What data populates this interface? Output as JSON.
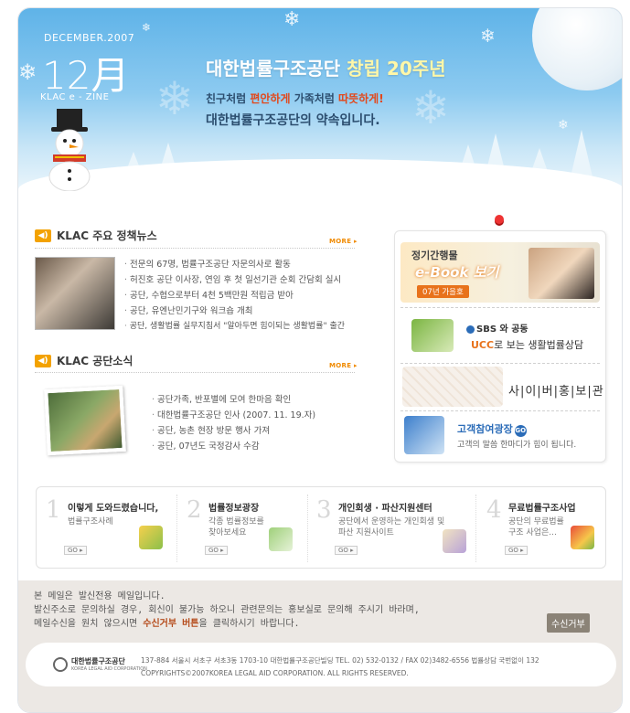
{
  "header": {
    "date_small": "DECEMBER.2007",
    "month": "12月",
    "zine": "KLAC e - ZINE",
    "title_main": "대한법률구조공단",
    "title_accent": "창립 20주년",
    "sub1_pre": "친구처럼 ",
    "sub1_hl1": "편안하게",
    "sub1_mid": " 가족처럼 ",
    "sub1_hl2": "따뜻하게!",
    "sub2": "대한법률구조공단의 약속입니다."
  },
  "policy_news": {
    "title": "KLAC 주요 정책뉴스",
    "more": "MORE ▸",
    "items": [
      "전문의 67명, 법률구조공단 자문의사로 활동",
      "허진호 공단 이사장, 연임 후 첫 일선기관 순회 간담회 실시",
      "공단, 수협으로부터 4천 5백만원 적립금 받아",
      "공단, 유엔난민기구와 워크숍 개최",
      "공단, 생활법률 실무지침서 \"알아두면 힘이되는 생활법률\" 출간"
    ]
  },
  "agency_news": {
    "title": "KLAC 공단소식",
    "more": "MORE ▸",
    "items": [
      "공단가족, 반포별에 모여 한마음 확인",
      "대한법률구조공단 인사 (2007. 11. 19.자)",
      "공단, 농촌 현장 방문 행사 가져",
      "공단, 07년도 국정감사 수감"
    ]
  },
  "side": {
    "ebook_t1": "정기간행물",
    "ebook_t2": "e-Book 보기",
    "ebook_t3": "07년 가을호",
    "sbs": "SBS 와 공동",
    "ucc_b": "UCC",
    "ucc_rest": "로 보는 생활법률상담",
    "cyber": "사|이|버|홍|보|관",
    "cust_title": "고객참여광장",
    "cust_go": "GO",
    "cust_sub": "고객의 말씀 한마디가 힘이 됩니다."
  },
  "boxes": [
    {
      "num": "1",
      "title": "이렇게 도와드렸습니다,",
      "desc": "법률구조사례",
      "go": "GO ▸"
    },
    {
      "num": "2",
      "title": "법률정보광장",
      "desc": "각종 법률정보를\n찾아보세요",
      "go": "GO ▸"
    },
    {
      "num": "3",
      "title": "개인회생 · 파산지원센터",
      "desc": "공단에서 운영하는 개인회생 및\n파산 지원사이트",
      "go": "GO ▸"
    },
    {
      "num": "4",
      "title": "무료법률구조사업",
      "desc": "공단의 무료법률\n구조 사업은...",
      "go": "GO ▸"
    }
  ],
  "footer": {
    "line1": "본 메일은 발신전용 메일입니다.",
    "line2": "발신주소로 문의하실 경우, 회신이 불가능 하오니 관련문의는 홍보실로 문의해 주시기 바라며,",
    "line3_pre": "메일수신을 원치 않으시면 ",
    "line3_link": "수신거부 버튼",
    "line3_post": "을 클릭하시기 바랍니다.",
    "unsubscribe": "수신거부",
    "logo_name": "대한법률구조공단",
    "logo_en": "KOREA LEGAL AID CORPORATION",
    "address": "137-884 서울시 서초구 서초3동 1703-10 대한법률구조공단빌딩      TEL. 02) 532-0132 / FAX 02)3482-6556 법률상담 국번없이 132",
    "copyright": "COPYRIGHTS©2007KOREA LEGAL AID CORPORATION. ALL RIGHTS RESERVED."
  }
}
